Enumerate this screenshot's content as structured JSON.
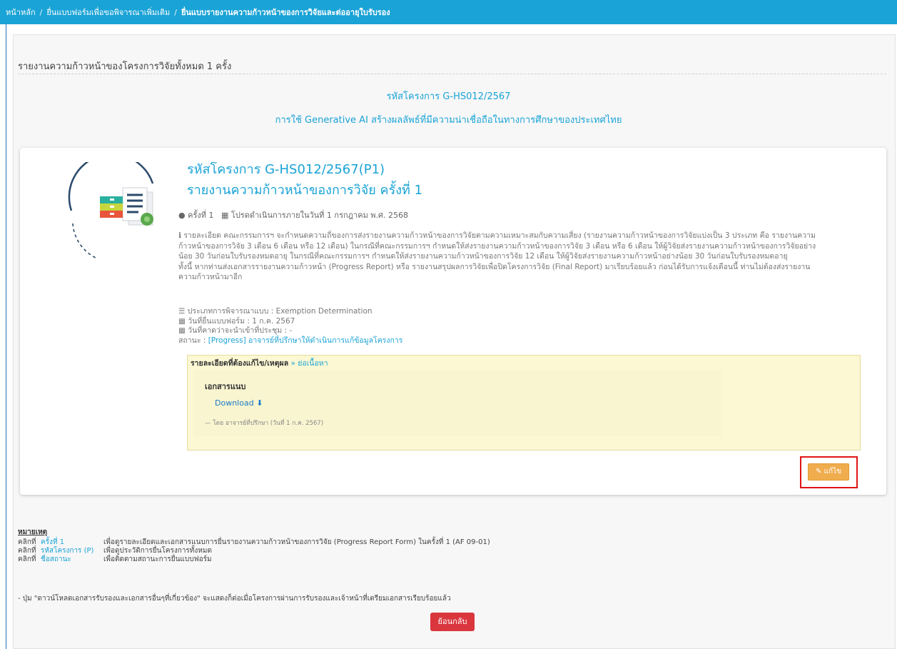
{
  "breadcrumb": {
    "home": "หน้าหลัก",
    "parent": "ยื่นแบบฟอร์มเพื่อขอพิจารณาเพิ่มเติม",
    "current": "ยื่นแบบรายงานความก้าวหน้าของการวิจัยและต่ออายุใบรับรอง",
    "separator": "/"
  },
  "panel": {
    "heading": "รายงานความก้าวหน้าของโครงการวิจัยทั้งหมด 1 ครั้ง",
    "project_code": "รหัสโครงการ G-HS012/2567",
    "project_title": "การใช้ Generative AI สร้างผลลัพธ์ที่มีความน่าเชื่อถือในทางการศึกษาของประเทศไทย"
  },
  "card": {
    "code": "รหัสโครงการ G-HS012/2567(P1)",
    "report": "รายงานความก้าวหน้าของการวิจัย ครั้งที่ 1",
    "round": "ครั้งที่ 1",
    "due": "โปรดดำเนินการภายในวันที่ 1 กรกฎาคม พ.ศ. 2568",
    "description_lines": [
      "รายละเอียด คณะกรรมการฯ จะกำหนดความถี่ของการส่งรายงานความก้าวหน้าของการวิจัยตามความเหมาะสมกับความเสี่ยง (รายงานความก้าวหน้าของการวิจัยแบ่งเป็น 3 ประเภท คือ รายงานความ",
      "ก้าวหน้าของการวิจัย 3 เดือน 6 เดือน หรือ 12 เดือน) ในกรณีที่คณะกรรมการฯ กำหนดให้ส่งรายงานความก้าวหน้าของการวิจัย 3 เดือน หรือ 6 เดือน ให้ผู้วิจัยส่งรายงานความก้าวหน้าของการวิจัยอย่าง",
      "น้อย 30 วันก่อนใบรับรองหมดอายุ ในกรณีที่คณะกรรมการฯ กำหนดให้ส่งรายงานความก้าวหน้าของการวิจัย 12 เดือน ให้ผู้วิจัยส่งรายงานความก้าวหน้าอย่างน้อย 30 วันก่อนใบรับรองหมดอายุ",
      "ทั้งนี้ หากท่านส่งเอกสารรายงานความก้าวหน้า (Progress Report) หรือ รายงานสรุปผลการวิจัยเพื่อปิดโครงการวิจัย (Final Report) มาเรียบร้อยแล้ว ก่อนได้รับการแจ้งเตือนนี้ ท่านไม่ต้องส่งรายงาน",
      "ความก้าวหน้ามาอีก"
    ],
    "review_type": "ประเภทการพิจารณาแบบ : Exemption Determination",
    "submit_date": "วันที่ยื่นแบบฟอร์ม : 1 ก.ค. 2567",
    "meeting_date": "วันที่คาดว่าจะนำเข้าที่ประชุม : -",
    "status_label": "สถานะ :",
    "status_value": "[Progress] อาจารย์ที่ปรึกษาให้ดำเนินการแก้ข้อมูลโครงการ",
    "revision_head": "รายละเอียดที่ต้องแก้ไข/เหตุผล",
    "revision_toggle": "» ย่อเนื้อหา",
    "attach_title": "เอกสารแนบ",
    "download_label": "Download",
    "attach_by": "— โดย อาจารย์ที่ปรึกษา (วันที่ 1 ก.ค. 2567)",
    "edit_label": "แก้ไข"
  },
  "notes": {
    "title": "หมายเหตุ",
    "rows": [
      {
        "prefix": "คลิกที่",
        "link": "ครั้งที่ 1",
        "text": "เพื่อดูรายละเอียดและเอกสารแนบการยื่นรายงานความก้าวหน้าของการวิจัย (Progress Report Form) ในครั้งที่ 1 (AF 09-01)"
      },
      {
        "prefix": "คลิกที่",
        "link": "รหัสโครงการ (P)",
        "text": "เพื่อดูประวัติการยื่นโครงการทั้งหมด"
      },
      {
        "prefix": "คลิกที่",
        "link": "ชื่อสถานะ",
        "text": "เพื่อติดตามสถานะการยื่นแบบฟอร์ม"
      }
    ],
    "download_note": "- ปุ่ม \"ดาวน์โหลดเอกสารรับรองและเอกสารอื่นๆที่เกี่ยวข้อง\" จะแสดงก็ต่อเมื่อโครงการผ่านการรับรองและเจ้าหน้าที่เตรียมเอกสารเรียบร้อยแล้ว"
  },
  "back_button": "ย้อนกลับ",
  "colors": {
    "topbar": "#1aa3d6",
    "link": "#1aa3d6",
    "edit_button": "#f0ad4e",
    "back_button": "#d9363e",
    "highlight": "#e01414",
    "revision_bg": "#fcf8d4"
  },
  "icons": [
    "circle-bullet-icon",
    "calendar-icon",
    "info-icon",
    "list-icon",
    "download-icon",
    "edit-icon",
    "document-illustration"
  ]
}
